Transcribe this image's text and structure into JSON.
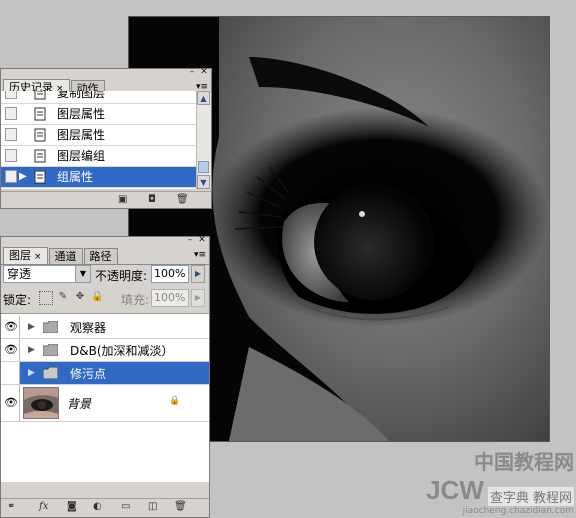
{
  "history_panel": {
    "tabs": [
      {
        "label": "历史记录",
        "close": "×"
      },
      {
        "label": "动作"
      }
    ],
    "menu_icon": "menu-icon",
    "items": [
      {
        "label": "复制图层",
        "selected": false
      },
      {
        "label": "图层属性",
        "selected": false
      },
      {
        "label": "图层属性",
        "selected": false
      },
      {
        "label": "图层编组",
        "selected": false
      },
      {
        "label": "组属性",
        "selected": true
      }
    ]
  },
  "layers_panel": {
    "tabs": [
      {
        "label": "图层",
        "close": "×"
      },
      {
        "label": "通道"
      },
      {
        "label": "路径"
      }
    ],
    "blend_mode": "穿透",
    "opacity_label": "不透明度:",
    "opacity_value": "100%",
    "lock_label": "锁定:",
    "fill_label": "填充:",
    "fill_value": "100%",
    "layers": [
      {
        "name": "观察器",
        "type": "group",
        "visible": true,
        "selected": false
      },
      {
        "name": "D&B(加深和减淡）",
        "type": "group",
        "visible": true,
        "selected": false
      },
      {
        "name": "修污点",
        "type": "group",
        "visible": true,
        "selected": true
      },
      {
        "name": "背景",
        "type": "background",
        "visible": true,
        "selected": false,
        "locked": true
      }
    ],
    "footer_labels": {
      "fx": "fx"
    }
  },
  "watermark": {
    "cn": "中国教程网",
    "jcw": "JCW",
    "cn2": "查字典 教程网",
    "url": "jiaocheng.chazidian.com"
  },
  "colors": {
    "selection": "#316ac5",
    "panel": "#d6d3ce",
    "workspace": "#c3c3c3"
  }
}
